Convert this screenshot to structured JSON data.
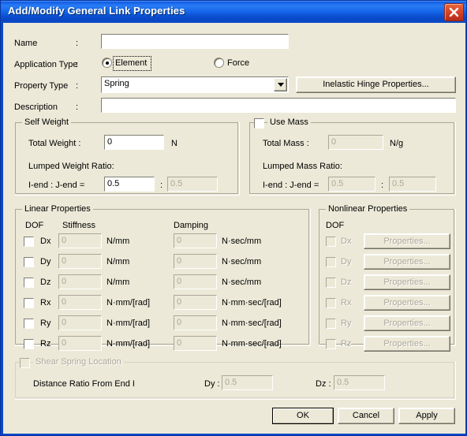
{
  "window": {
    "title": "Add/Modify General Link Properties",
    "close_icon": "close-icon"
  },
  "form": {
    "name_label": "Name",
    "name_colon": ":",
    "name_value": "",
    "application_type_label": "Application Type",
    "application_type_colon": ":",
    "application_type_options": [
      "Element",
      "Force"
    ],
    "application_type_selected": "Element",
    "property_type_label": "Property Type",
    "property_type_colon": ":",
    "property_type_value": "Spring",
    "inelastic_hinge_button": "Inelastic Hinge Properties...",
    "description_label": "Description",
    "description_colon": ":",
    "description_value": ""
  },
  "self_weight": {
    "title": "Self Weight",
    "total_weight_label": "Total Weight :",
    "total_weight_value": "0",
    "total_weight_unit": "N",
    "lumped_ratio_label": "Lumped Weight Ratio:",
    "ends_label": "I-end : J-end =",
    "i_end_value": "0.5",
    "ratio_separator": ":",
    "j_end_value": "0.5"
  },
  "use_mass": {
    "title": "Use Mass",
    "checked": false,
    "total_mass_label": "Total Mass :",
    "total_mass_value": "0",
    "total_mass_unit": "N/g",
    "lumped_ratio_label": "Lumped Mass Ratio:",
    "ends_label": "I-end : J-end =",
    "i_end_value": "0.5",
    "ratio_separator": ":",
    "j_end_value": "0.5"
  },
  "linear_properties": {
    "title": "Linear Properties",
    "col_dof": "DOF",
    "col_stiffness": "Stiffness",
    "col_damping": "Damping",
    "rows": [
      {
        "dof": "Dx",
        "checked": false,
        "stiffness": "0",
        "stiffness_unit": "N/mm",
        "damping": "0",
        "damping_unit": "N·sec/mm"
      },
      {
        "dof": "Dy",
        "checked": false,
        "stiffness": "0",
        "stiffness_unit": "N/mm",
        "damping": "0",
        "damping_unit": "N·sec/mm"
      },
      {
        "dof": "Dz",
        "checked": false,
        "stiffness": "0",
        "stiffness_unit": "N/mm",
        "damping": "0",
        "damping_unit": "N·sec/mm"
      },
      {
        "dof": "Rx",
        "checked": false,
        "stiffness": "0",
        "stiffness_unit": "N·mm/[rad]",
        "damping": "0",
        "damping_unit": "N·mm·sec/[rad]"
      },
      {
        "dof": "Ry",
        "checked": false,
        "stiffness": "0",
        "stiffness_unit": "N·mm/[rad]",
        "damping": "0",
        "damping_unit": "N·mm·sec/[rad]"
      },
      {
        "dof": "Rz",
        "checked": false,
        "stiffness": "0",
        "stiffness_unit": "N·mm/[rad]",
        "damping": "0",
        "damping_unit": "N·mm·sec/[rad]"
      }
    ]
  },
  "nonlinear_properties": {
    "title": "Nonlinear Properties",
    "col_dof": "DOF",
    "rows": [
      {
        "dof": "Dx",
        "checked": false,
        "button": "Properties..."
      },
      {
        "dof": "Dy",
        "checked": false,
        "button": "Properties..."
      },
      {
        "dof": "Dz",
        "checked": false,
        "button": "Properties..."
      },
      {
        "dof": "Rx",
        "checked": false,
        "button": "Properties..."
      },
      {
        "dof": "Ry",
        "checked": false,
        "button": "Properties..."
      },
      {
        "dof": "Rz",
        "checked": false,
        "button": "Properties..."
      }
    ]
  },
  "shear_spring": {
    "title": "Shear Spring Location",
    "checked": false,
    "distance_label": "Distance Ratio From End I",
    "dy_label": "Dy :",
    "dy_value": "0.5",
    "dz_label": "Dz :",
    "dz_value": "0.5"
  },
  "footer": {
    "ok": "OK",
    "cancel": "Cancel",
    "apply": "Apply"
  },
  "colors": {
    "title_bar": "#1663e8",
    "dialog_bg": "#ece9d8",
    "close_button": "#d8472a",
    "disabled_text": "#aca899"
  }
}
